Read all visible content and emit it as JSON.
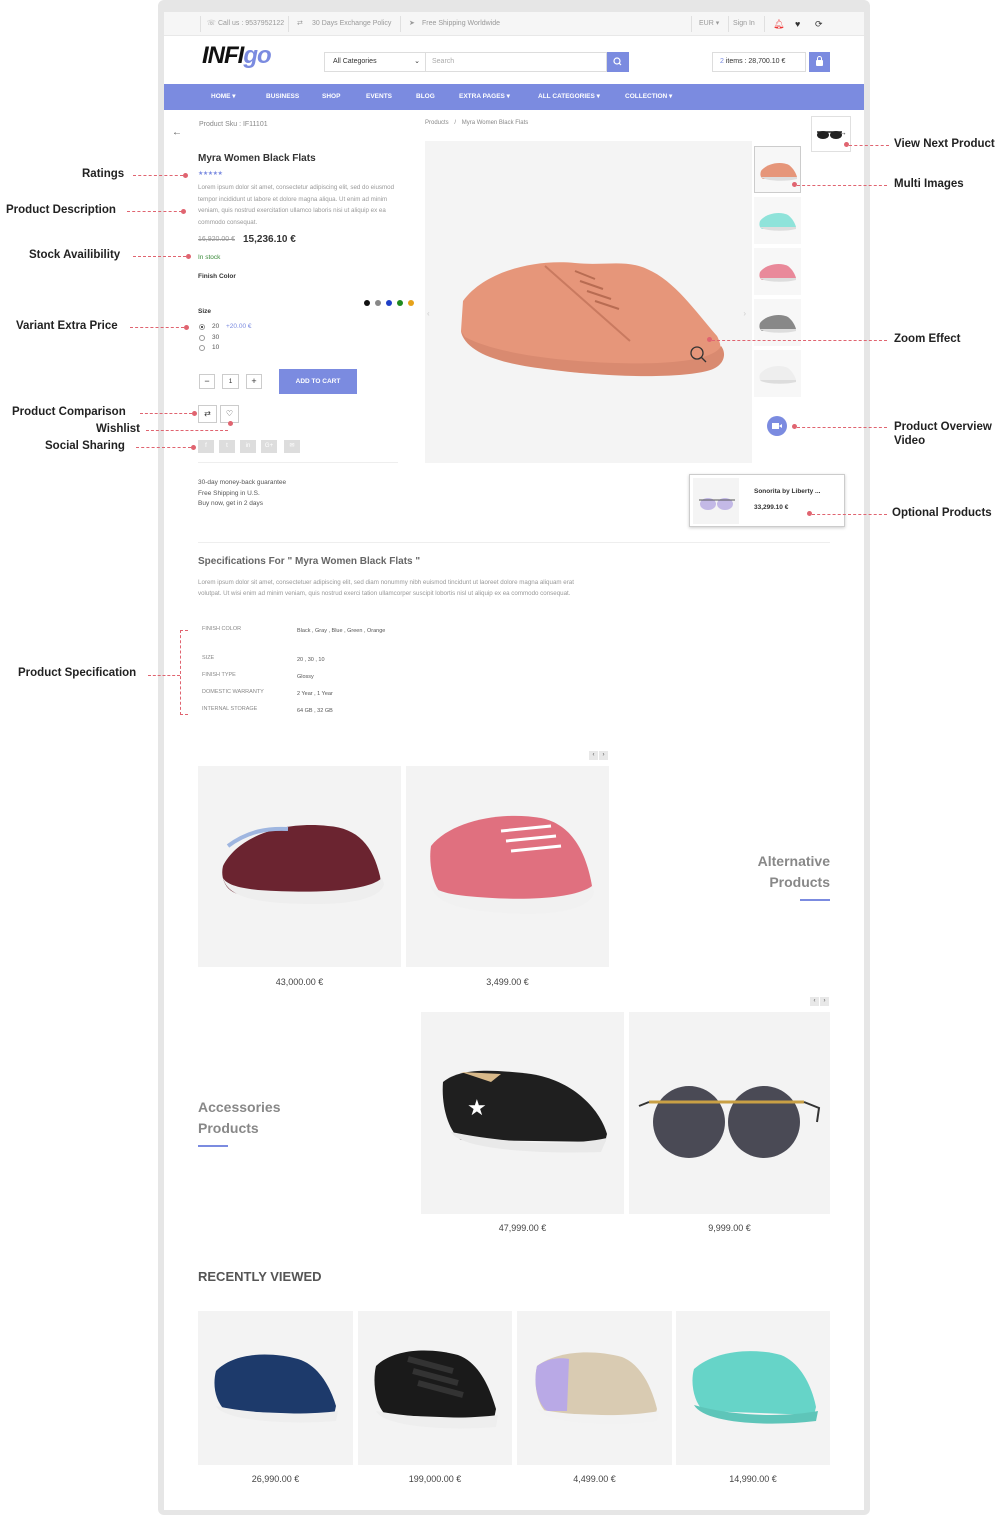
{
  "topbar": {
    "call": "Call us : 9537952122",
    "exchange": "30 Days Exchange Policy",
    "shipping": "Free Shipping Worldwide",
    "currency": "EUR",
    "signin": "Sign In"
  },
  "header": {
    "logo_main": "INFI",
    "logo_accent": "go",
    "category": "All Categories",
    "search_placeholder": "Search",
    "cart_count": "2",
    "cart_text": "items : 28,700.10 €"
  },
  "nav": [
    "HOME",
    "BUSINESS",
    "SHOP",
    "EVENTS",
    "BLOG",
    "EXTRA PAGES",
    "ALL CATEGORIES",
    "COLLECTION"
  ],
  "breadcrumb": {
    "root": "Products",
    "sep": "/",
    "current": "Myra Women Black Flats"
  },
  "product": {
    "sku": "Product Sku : IF11101",
    "title": "Myra Women Black Flats",
    "stars": "★★★★★",
    "description": "Lorem ipsum dolor sit amet, consectetur adipiscing elit, sed do eiusmod tempor incididunt ut labore et dolore magna aliqua. Ut enim ad minim veniam, quis nostrud exercitation ullamco laboris nisi ut aliquip ex ea commodo consequat.",
    "old_price": "16,920.00 €",
    "price": "15,236.10 €",
    "stock": "In stock",
    "finish_label": "Finish Color",
    "colors": [
      "#111111",
      "#888888",
      "#1f3fc7",
      "#1f8a1f",
      "#e6a21a"
    ],
    "size_label": "Size",
    "sizes": [
      "20",
      "30",
      "10"
    ],
    "extra_price": "+20.00 €",
    "qty": "1",
    "add_to_cart": "ADD TO CART",
    "guarantee": [
      "30-day money-back guarantee",
      "Free Shipping in U.S.",
      "Buy now, get in 2 days"
    ]
  },
  "optional": {
    "name": "Sonorita by Liberty ...",
    "price": "33,299.10 €"
  },
  "annotations": {
    "ratings": "Ratings",
    "description": "Product Description",
    "stock": "Stock Availibility",
    "variant": "Variant Extra Price",
    "comparison": "Product Comparison",
    "wishlist": "Wishlist",
    "social": "Social Sharing",
    "spec": "Product Specification",
    "next": "View Next Product",
    "multi": "Multi Images",
    "zoom": "Zoom Effect",
    "video": "Product Overview Video",
    "optional": "Optional Products"
  },
  "specs": {
    "title": "Specifications For \" Myra Women Black Flats \"",
    "text": "Lorem ipsum dolor sit amet, consectetuer adipiscing elit, sed diam nonummy nibh euismod tincidunt ut laoreet dolore magna aliquam erat volutpat. Ut wisi enim ad minim veniam, quis nostrud exerci tation ullamcorper suscipit lobortis nisl ut aliquip ex ea commodo consequat.",
    "rows": [
      {
        "k": "FINISH COLOR",
        "v": "Black , Gray , Blue , Green , Orange"
      },
      {
        "k": "SIZE",
        "v": "20 , 30 , 10"
      },
      {
        "k": "FINISH TYPE",
        "v": "Glossy"
      },
      {
        "k": "DOMESTIC WARRANTY",
        "v": "2 Year , 1 Year"
      },
      {
        "k": "INTERNAL STORAGE",
        "v": "64 GB , 32 GB"
      }
    ]
  },
  "alternative": {
    "title_1": "Alternative",
    "title_2": "Products",
    "prices": [
      "43,000.00 €",
      "3,499.00 €"
    ]
  },
  "accessories": {
    "title_1": "Accessories",
    "title_2": "Products",
    "prices": [
      "47,999.00 €",
      "9,999.00 €"
    ]
  },
  "recent": {
    "title": "RECENTLY VIEWED",
    "prices": [
      "26,990.00 €",
      "199,000.00 €",
      "4,499.00 €",
      "14,990.00 €"
    ]
  }
}
